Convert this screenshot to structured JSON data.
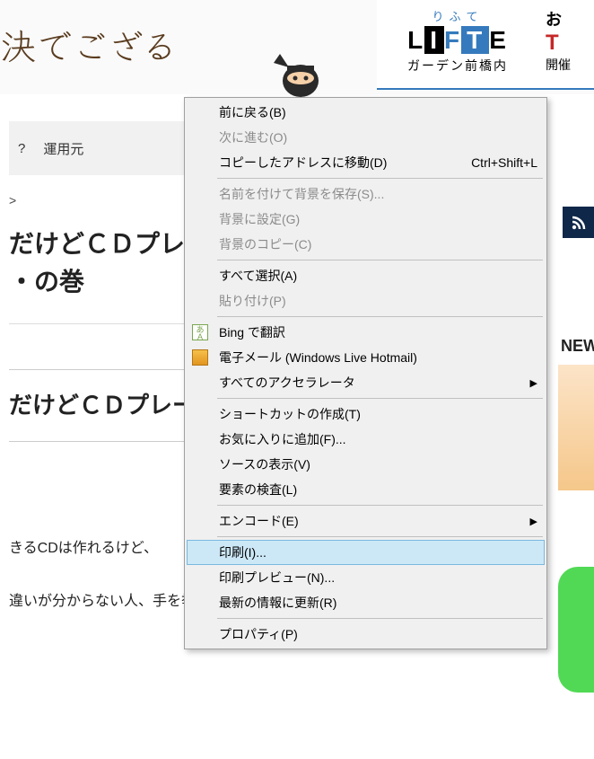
{
  "header": {
    "logo_text": "決でござる",
    "ad": {
      "small": "りふて",
      "logo_l": "L",
      "logo_i": "I",
      "logo_f": "F",
      "logo_t": "T",
      "logo_e": "E",
      "sub": "ガーデン前橋内",
      "right1": "お",
      "right2": "T",
      "right3": "開催"
    }
  },
  "nav": {
    "item1": "?",
    "item2": "運用元"
  },
  "breadcrumb": ">",
  "article": {
    "title_line1": "だけどＣＤプレ",
    "title_line2": "・の巻",
    "subtitle": "だけどＣＤプレー",
    "body1": "きるCDは作れるけど、",
    "body2": "違いが分からない人、手を挙げるでござる！"
  },
  "sidebar": {
    "new_label": "NEW"
  },
  "contextMenu": {
    "back": "前に戻る(B)",
    "forward": "次に進む(O)",
    "goToCopied": "コピーしたアドレスに移動(D)",
    "goToCopiedShortcut": "Ctrl+Shift+L",
    "saveBgAs": "名前を付けて背景を保存(S)...",
    "setBg": "背景に設定(G)",
    "copyBg": "背景のコピー(C)",
    "selectAll": "すべて選択(A)",
    "paste": "貼り付け(P)",
    "bingTranslate": "Bing で翻訳",
    "email": "電子メール (Windows Live Hotmail)",
    "allAccelerators": "すべてのアクセラレータ",
    "createShortcut": "ショートカットの作成(T)",
    "addFavorites": "お気に入りに追加(F)...",
    "viewSource": "ソースの表示(V)",
    "inspectElement": "要素の検査(L)",
    "encoding": "エンコード(E)",
    "print": "印刷(I)...",
    "printPreview": "印刷プレビュー(N)...",
    "refresh": "最新の情報に更新(R)",
    "properties": "プロパティ(P)"
  }
}
